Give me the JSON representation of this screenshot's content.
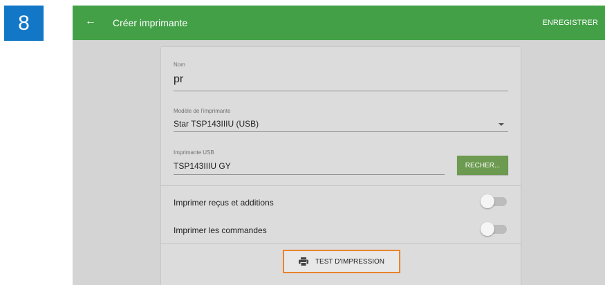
{
  "step": {
    "number": "8"
  },
  "appbar": {
    "back_icon": "arrow-left-icon",
    "title": "Créer imprimante",
    "save_label": "ENREGISTRER",
    "color": "#43a047"
  },
  "form": {
    "name": {
      "label": "Nom",
      "value": "pr"
    },
    "model": {
      "label": "Modèle de l'imprimante",
      "value": "Star TSP143IIIU (USB)"
    },
    "usb": {
      "label": "Imprimante USB",
      "value": "TSP143IIIU GY"
    },
    "search_button": "RECHER...",
    "toggles": [
      {
        "label": "Imprimer reçus et additions",
        "on": false
      },
      {
        "label": "Imprimer les commandes",
        "on": false
      }
    ],
    "test_print": {
      "icon": "printer-icon",
      "label": "TEST D'IMPRESSION"
    }
  },
  "colors": {
    "accent": "#43a047",
    "step_badge": "#1177c6",
    "highlight": "#e8832e",
    "search_button": "#6c9a50"
  }
}
